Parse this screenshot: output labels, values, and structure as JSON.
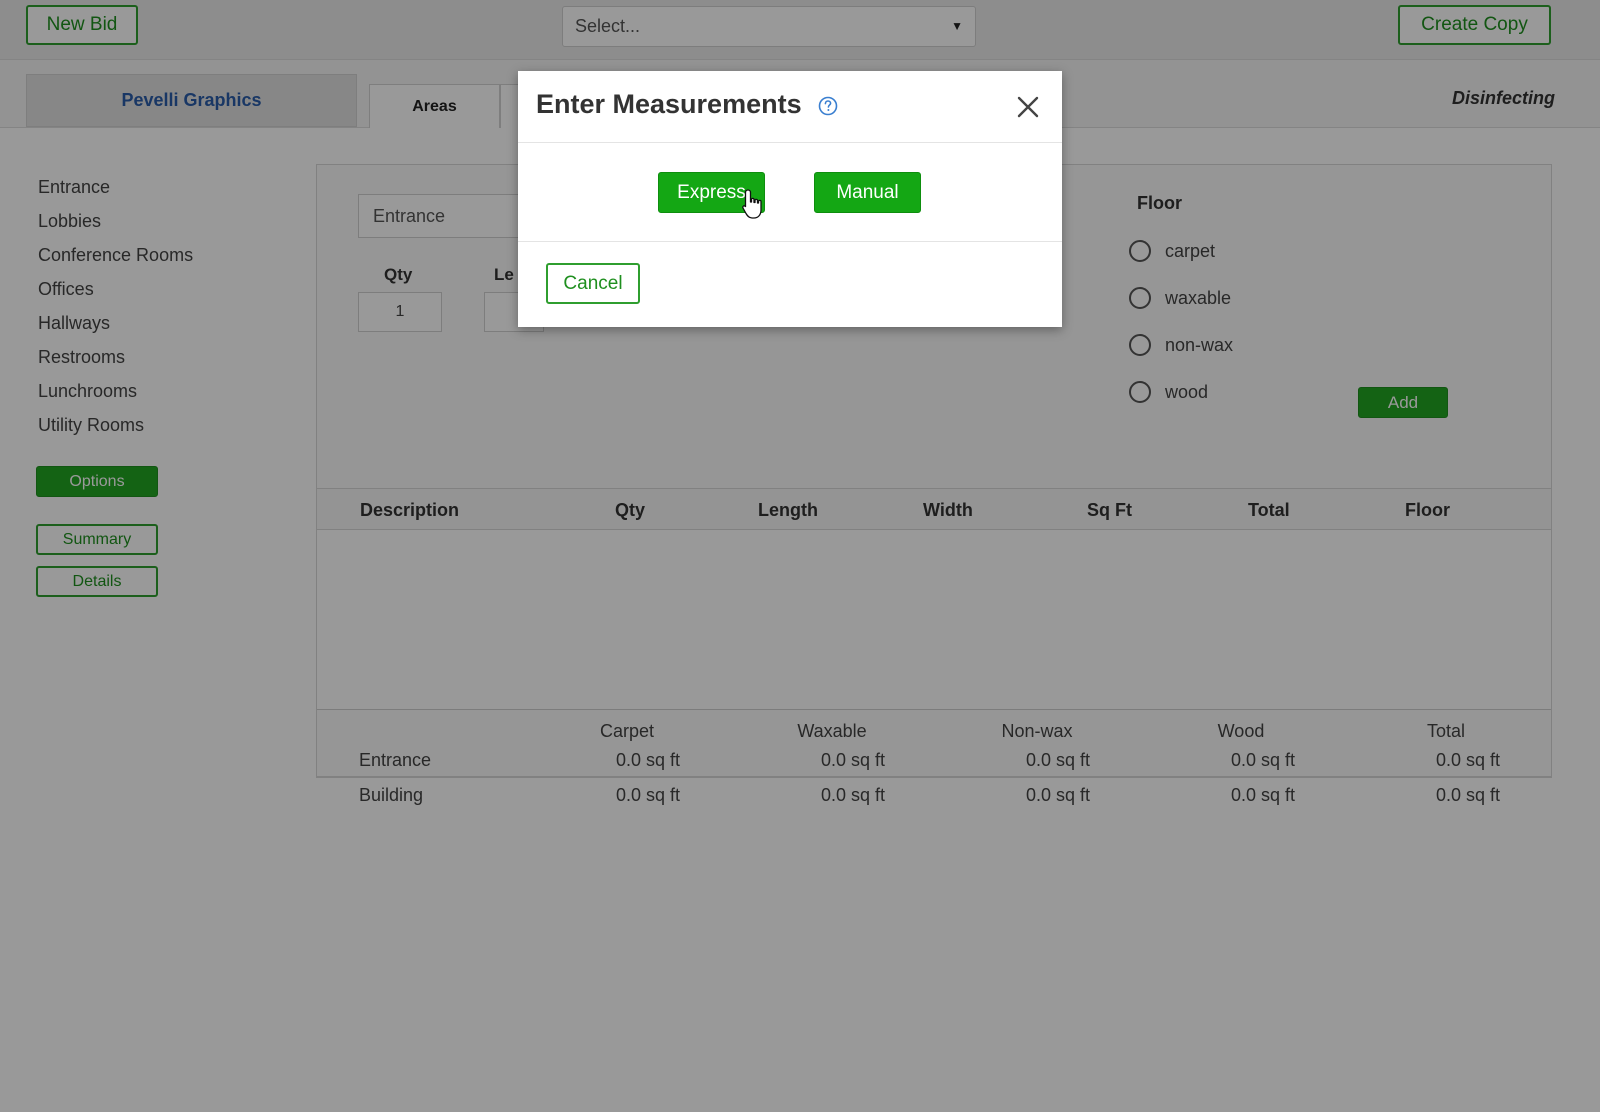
{
  "topbar": {
    "new_bid_label": "New Bid",
    "select_placeholder": "Select...",
    "create_copy_label": "Create Copy"
  },
  "tabs": {
    "company": "Pevelli Graphics",
    "areas": "Areas",
    "service": "Disinfecting"
  },
  "sidebar": {
    "items": [
      {
        "label": "Entrance"
      },
      {
        "label": "Lobbies"
      },
      {
        "label": "Conference Rooms"
      },
      {
        "label": "Offices"
      },
      {
        "label": "Hallways"
      },
      {
        "label": "Restrooms"
      },
      {
        "label": "Lunchrooms"
      },
      {
        "label": "Utility Rooms"
      }
    ],
    "options_label": "Options",
    "summary_label": "Summary",
    "details_label": "Details"
  },
  "form": {
    "area_value": "Entrance",
    "qty_label": "Qty",
    "qty_value": "1",
    "length_label_partial": "Le",
    "floor_title": "Floor",
    "floor_options": [
      "carpet",
      "waxable",
      "non-wax",
      "wood"
    ],
    "add_label": "Add"
  },
  "table": {
    "columns": [
      "Description",
      "Qty",
      "Length",
      "Width",
      "Sq Ft",
      "Total",
      "Floor"
    ],
    "rows": []
  },
  "summary": {
    "columns": [
      "Carpet",
      "Waxable",
      "Non-wax",
      "Wood",
      "Total"
    ],
    "rows": [
      {
        "label": "Entrance",
        "values": [
          "0.0 sq ft",
          "0.0 sq ft",
          "0.0 sq ft",
          "0.0 sq ft",
          "0.0 sq ft"
        ]
      },
      {
        "label": "Building",
        "values": [
          "0.0 sq ft",
          "0.0 sq ft",
          "0.0 sq ft",
          "0.0 sq ft",
          "0.0 sq ft"
        ]
      }
    ]
  },
  "modal": {
    "title": "Enter Measurements",
    "express_label": "Express",
    "manual_label": "Manual",
    "cancel_label": "Cancel"
  },
  "colors": {
    "accent_green": "#22a522",
    "company_blue": "#2a5ca8"
  }
}
